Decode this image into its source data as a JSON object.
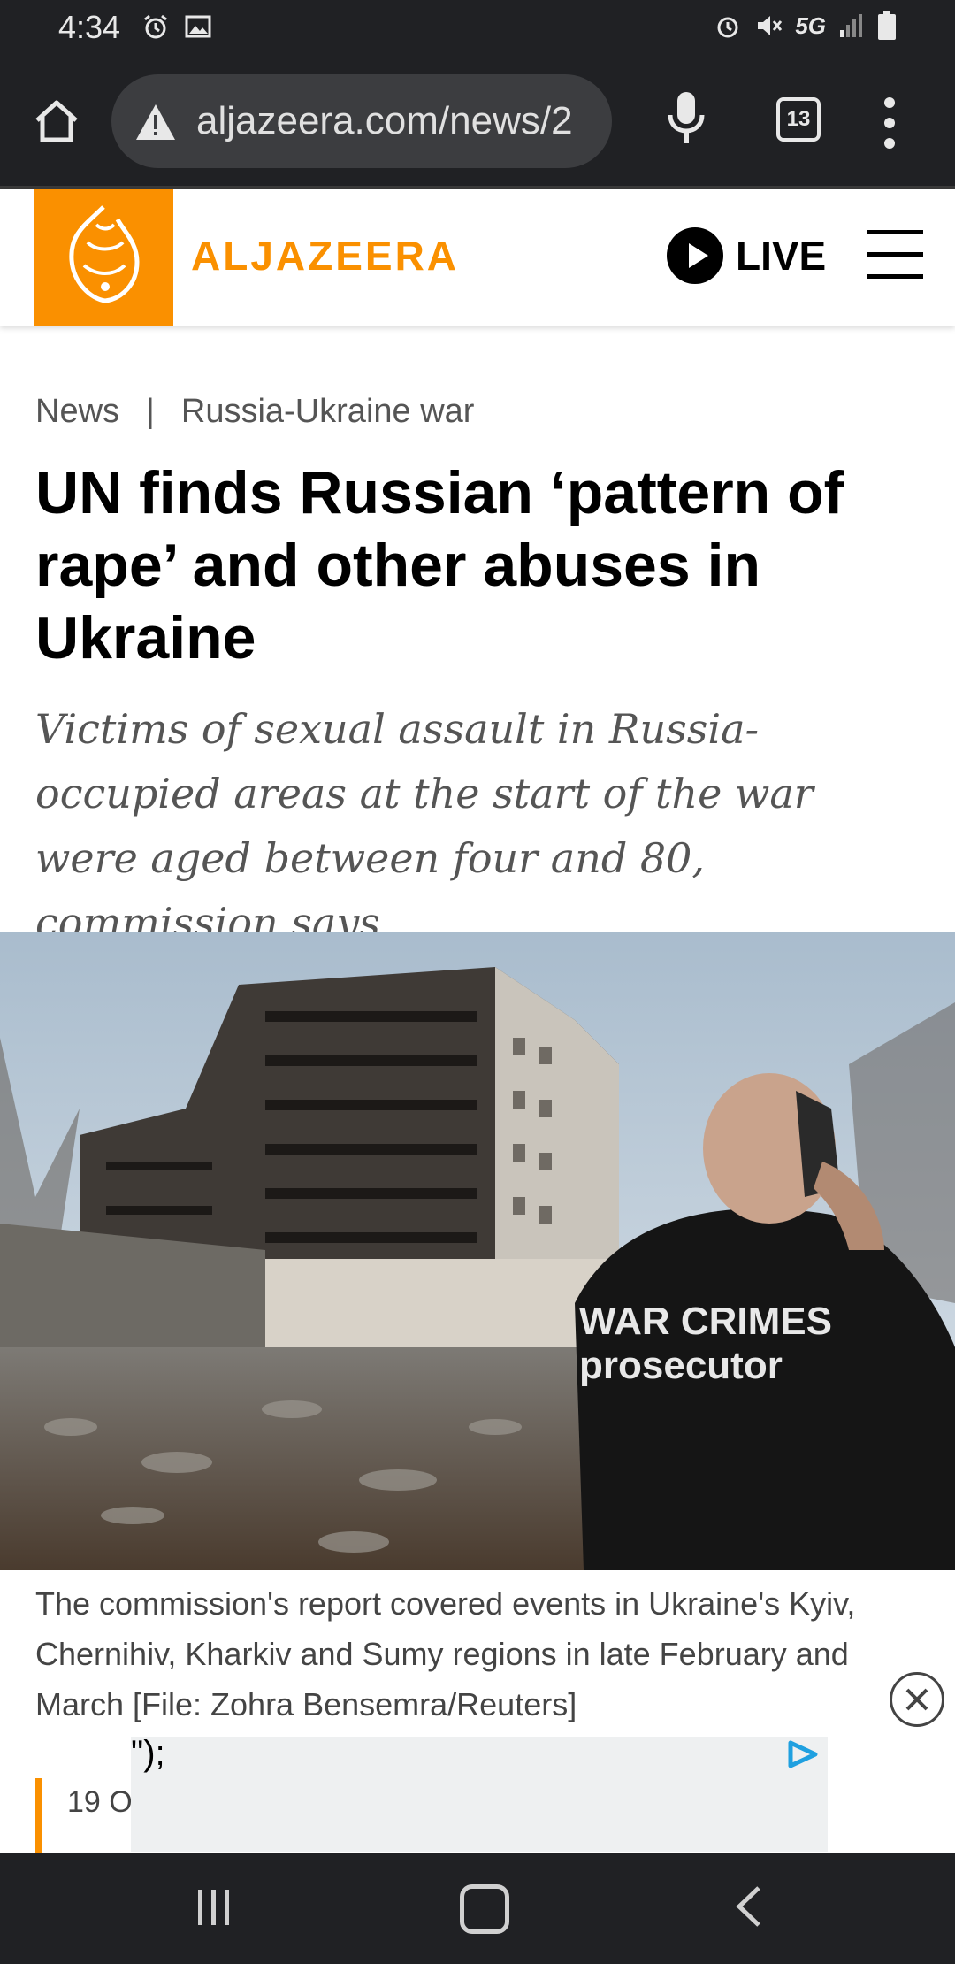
{
  "status_bar": {
    "time": "4:34",
    "left_icons": [
      "alarm-icon",
      "image-icon"
    ],
    "network": "5G",
    "right_icons": [
      "alarm-icon",
      "mute-icon",
      "signal-icon",
      "battery-icon"
    ]
  },
  "browser": {
    "url": "aljazeera.com/news/2",
    "tab_count": "13"
  },
  "site": {
    "brand": "ALJAZEERA",
    "live_label": "LIVE",
    "brand_color": "#fa9000"
  },
  "article": {
    "breadcrumb": {
      "section": "News",
      "separator": "|",
      "topic": "Russia-Ukraine war"
    },
    "headline": "UN finds Russian ‘pattern of rape’ and other abuses in Ukraine",
    "subheadline": "Victims of sexual assault in Russia-occupied areas at the start of the war were aged between four and 80, commission says.",
    "image_text": {
      "vest_line1": "WAR CRIMES",
      "vest_line2": "prosecutor"
    },
    "caption": "The commission's report covered events in Ukraine's Kyiv, Chernihiv, Kharkiv and Sumy regions in late February and March [File: Zohra Bensemra/Reuters]",
    "date_partial": "19 O"
  },
  "ad": {
    "stray_text": "\");"
  }
}
